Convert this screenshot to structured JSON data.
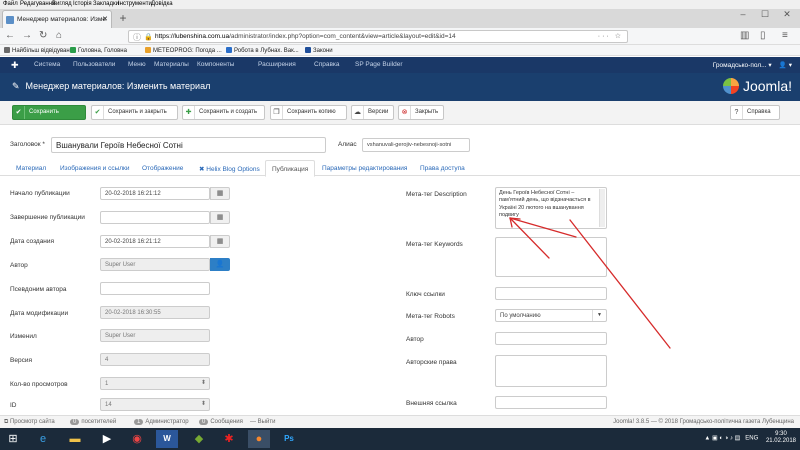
{
  "browser": {
    "menu": [
      "Файл",
      "Редагування",
      "Вигляд",
      "Історія",
      "Закладки",
      "Інструменти",
      "Довідка"
    ],
    "tab_title": "Менеджер материалов: Изме",
    "url_host": "https://lubenshina.com.ua",
    "url_path": "/administrator/index.php?option=com_content&view=article&layout=edit&id=14",
    "bookmarks": [
      "Найбільш відвідувані",
      "Головна, Головна",
      "МЕТЕОPROG: Погода ...",
      "Робота в Лубнах. Вак...",
      "Закони"
    ]
  },
  "admin_nav": {
    "items": [
      "Система",
      "Пользователи",
      "Меню",
      "Материалы",
      "Компоненты",
      "Расширения",
      "Справка",
      "SP Page Builder"
    ],
    "site_name": "Громадсько-пол..."
  },
  "header": {
    "title": "Менеджер материалов: Изменить материал",
    "brand": "Joomla!"
  },
  "toolbar": {
    "save": "Сохранить",
    "save_close": "Сохранить и закрыть",
    "save_new": "Сохранить и создать",
    "save_copy": "Сохранить копию",
    "versions": "Версии",
    "close": "Закрыть",
    "help": "Справка"
  },
  "form": {
    "title_label": "Заголовок *",
    "title_value": "Вшанували Героїв Небесної Сотні",
    "alias_label": "Алиас",
    "alias_value": "vshanuvali-gerojiv-nebesnoji-sotni"
  },
  "tabs": [
    "Материал",
    "Изображения и ссылки",
    "Отображение",
    "Helix Blog Options",
    "Публикация",
    "Параметры редактирования",
    "Права доступа"
  ],
  "publishing": {
    "publish_up_label": "Начало публикации",
    "publish_up": "20-02-2018 16:21:12",
    "publish_down_label": "Завершение публикации",
    "created_label": "Дата создания",
    "created": "20-02-2018 16:21:12",
    "author_label": "Автор",
    "author": "Super User",
    "alias_author_label": "Псевдоним автора",
    "modified_label": "Дата модификации",
    "modified": "20-02-2018 16:30:55",
    "modified_by_label": "Изменил",
    "modified_by": "Super User",
    "version_label": "Версия",
    "version": "4",
    "hits_label": "Кол-во просмотров",
    "hits": "1",
    "id_label": "ID",
    "id": "14"
  },
  "metadata": {
    "description_label": "Мета-тег Description",
    "description": "День Героїв Небесної Сотні – пам'ятний день, що відзначається в Україні 20 лютого на вшанування подвигу",
    "keywords_label": "Мета-тег Keywords",
    "key_ref_label": "Ключ ссылки",
    "robots_label": "Мета-тег Robots",
    "robots": "По умолчанию",
    "author_label": "Автор",
    "rights_label": "Авторские права",
    "xreference_label": "Внешняя ссылка"
  },
  "footer": {
    "view_site": "Просмотр сайта",
    "visitors_count": "0",
    "visitors": "посетителей",
    "admins_count": "1",
    "admins": "Администратор",
    "messages_count": "0",
    "messages": "Сообщения",
    "logout": "Выйти",
    "copyright": "Joomla! 3.8.5 — © 2018 Громадсько-політична газета Лубенщина"
  },
  "taskbar": {
    "lang": "ENG",
    "time": "9:30",
    "date": "21.02.2018"
  },
  "colors": {
    "admin_nav": "#1a3867",
    "header": "#1a3f6e",
    "save_green": "#3b9e47",
    "link_blue": "#2a69b8",
    "arrow_red": "#d62b2b"
  }
}
